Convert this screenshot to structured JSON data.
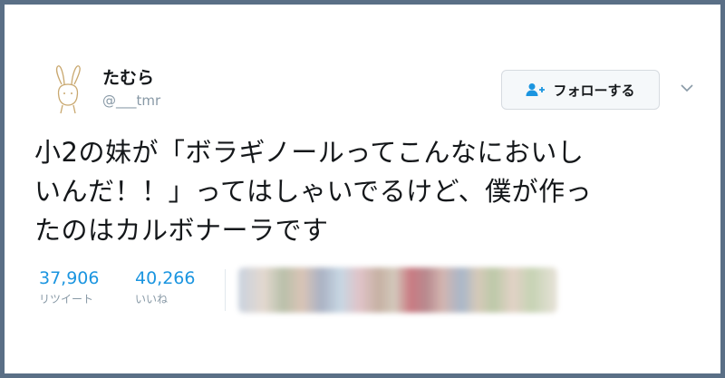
{
  "tweet": {
    "display_name": "たむら",
    "screen_name": "@___tmr",
    "follow_label": "フォローする",
    "text_lines": [
      "小2の妹が「ボラギノールってこんなにおいし",
      "いんだ！！」ってはしゃいでるけど、僕が作っ",
      "たのはカルボナーラです"
    ],
    "stats": {
      "retweets": {
        "value": "37,906",
        "label": "リツイート"
      },
      "likes": {
        "value": "40,266",
        "label": "いいね"
      }
    },
    "icons": {
      "avatar": "rabbit-avatar-icon",
      "follow": "add-user-icon",
      "caret": "chevron-down-icon"
    }
  },
  "colors": {
    "frame": "#5a6f86",
    "link_blue": "#1b95e0",
    "text": "#14171a",
    "muted": "#8899a6"
  }
}
